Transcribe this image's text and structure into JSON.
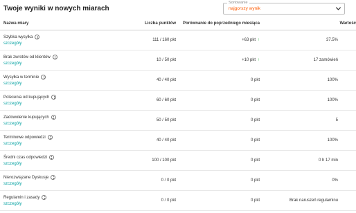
{
  "title": "Twoje wyniki w nowych miarach",
  "sort": {
    "label": "Sortowanie",
    "value": "najgorszy wynik"
  },
  "columns": {
    "name": "Nazwa miary",
    "points": "Liczba punktów",
    "compare": "Porównanie do poprzedniego miesiąca",
    "value": "Wartość"
  },
  "details_label": "szczegóły",
  "rows": [
    {
      "name": "Szybka wysyłka",
      "points": "111 / 160 pkt",
      "compare": "+63 pkt",
      "trend": "up",
      "value": "37.5%"
    },
    {
      "name": "Brak zwrotów od klientów",
      "points": "10 / 50 pkt",
      "compare": "+10 pkt",
      "trend": "up",
      "value": "17 zamówień"
    },
    {
      "name": "Wysyłka w terminie",
      "points": "40 / 40 pkt",
      "compare": "0 pkt",
      "trend": "none",
      "value": "100%"
    },
    {
      "name": "Polecenia od kupujących",
      "points": "60 / 60 pkt",
      "compare": "0 pkt",
      "trend": "none",
      "value": "100%"
    },
    {
      "name": "Zadowolenie kupujących",
      "points": "50 / 50 pkt",
      "compare": "0 pkt",
      "trend": "none",
      "value": "5"
    },
    {
      "name": "Terminowe odpowiedzi",
      "points": "40 / 40 pkt",
      "compare": "0 pkt",
      "trend": "none",
      "value": "100%"
    },
    {
      "name": "Średni czas odpowiedzi",
      "points": "100 / 100 pkt",
      "compare": "0 pkt",
      "trend": "none",
      "value": "0 h 17 min"
    },
    {
      "name": "Nierozwiązane Dyskusje",
      "points": "0 / 0 pkt",
      "compare": "0 pkt",
      "trend": "none",
      "value": "0%"
    },
    {
      "name": "Regulamin i zasady",
      "points": "0 / 0 pkt",
      "compare": "0 pkt",
      "trend": "none",
      "value": "Brak naruszeń regulaminu"
    }
  ],
  "colors": {
    "sort_value": "#ff5a00",
    "details_link": "#00a0a0",
    "trend_up": "#2db640"
  }
}
